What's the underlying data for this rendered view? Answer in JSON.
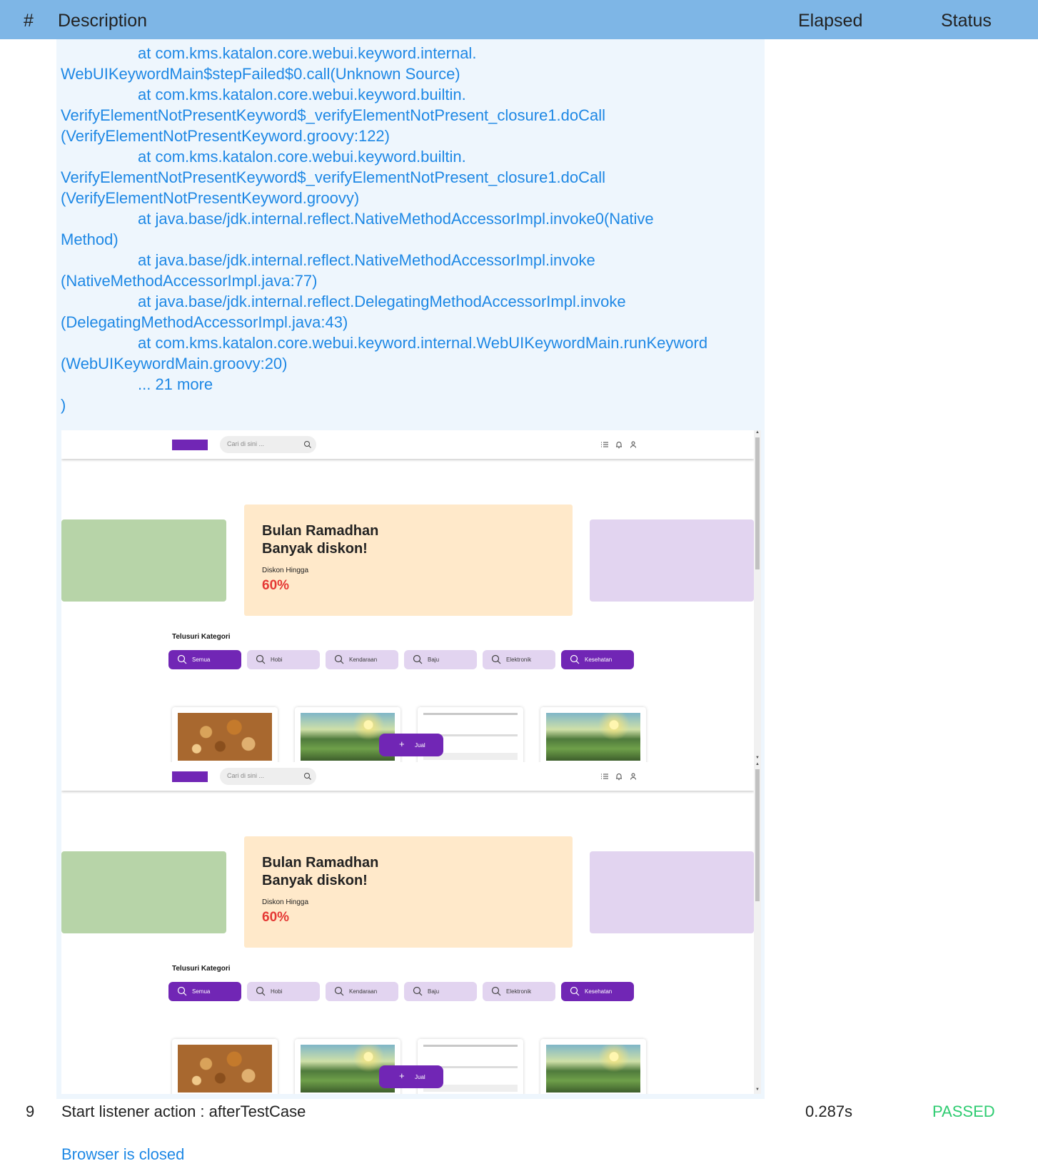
{
  "table": {
    "header": {
      "num": "#",
      "description": "Description",
      "elapsed": "Elapsed",
      "status": "Status"
    }
  },
  "log": {
    "lines": [
      "at com.kms.katalon.core.webui.keyword.internal.",
      "WebUIKeywordMain$stepFailed$0.call(Unknown Source)",
      "at com.kms.katalon.core.webui.keyword.builtin.",
      "VerifyElementNotPresentKeyword$_verifyElementNotPresent_closure1.doCall",
      "(VerifyElementNotPresentKeyword.groovy:122)",
      "at com.kms.katalon.core.webui.keyword.builtin.",
      "VerifyElementNotPresentKeyword$_verifyElementNotPresent_closure1.doCall",
      "(VerifyElementNotPresentKeyword.groovy)",
      "at java.base/jdk.internal.reflect.NativeMethodAccessorImpl.invoke0(Native",
      "Method)",
      "at java.base/jdk.internal.reflect.NativeMethodAccessorImpl.invoke",
      "(NativeMethodAccessorImpl.java:77)",
      "at java.base/jdk.internal.reflect.DelegatingMethodAccessorImpl.invoke",
      "(DelegatingMethodAccessorImpl.java:43)",
      "at com.kms.katalon.core.webui.keyword.internal.WebUIKeywordMain.runKeyword",
      "(WebUIKeywordMain.groovy:20)",
      "... 21 more",
      ")"
    ]
  },
  "screenshot": {
    "search_placeholder": "Cari di sini ...",
    "banner_title_line1": "Bulan Ramadhan",
    "banner_title_line2": "Banyak diskon!",
    "banner_sub": "Diskon Hingga",
    "banner_pct": "60%",
    "category_title": "Telusuri Kategori",
    "categories": [
      "Semua",
      "Hobi",
      "Kendaraan",
      "Baju",
      "Elektronik",
      "Kesehatan"
    ],
    "jual_label": "Jual",
    "colors": {
      "brand": "#7126b5",
      "banner": "#ffe9ca",
      "accent_red": "#e53935"
    },
    "icons": [
      "list-icon",
      "bell-icon",
      "user-icon",
      "search-icon",
      "plus-icon"
    ]
  },
  "row9": {
    "num": "9",
    "description": "Start listener action : afterTestCase",
    "elapsed": "0.287s",
    "status": "PASSED",
    "note": "Browser is closed"
  }
}
